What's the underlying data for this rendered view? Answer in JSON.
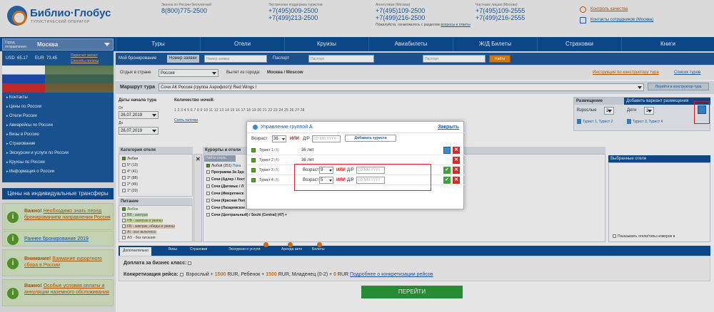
{
  "header": {
    "logo": {
      "name": "Библио·Глобус",
      "tagline": "ТУРИСТИЧЕСКИЙ ОПЕРАТОР"
    },
    "free_calls": {
      "label": "Звонок по России бесплатный",
      "phones": [
        "8(800)775-2500"
      ]
    },
    "emergency": {
      "label": "Экстренная поддержка туристов",
      "phones": [
        "+7(495)009-2500",
        "+7(499)213-2500"
      ]
    },
    "agencies": {
      "label": "Агентствам (Москва)",
      "phones": [
        "+7(495)109-2500",
        "+7(499)216-2500"
      ],
      "note_prefix": "Пожалуйста, ознакомьтесь с разделом",
      "note_link": "вопросы и ответы"
    },
    "private": {
      "label": "Частным лицам (Москва)",
      "phones": [
        "+7(495)109-2555",
        "+7(499)216-2555"
      ]
    },
    "quality_link": "Контроль качества",
    "staff_link": "Контакты сотрудников (Москва)"
  },
  "city": {
    "label": "Город отправления",
    "value": "Москва"
  },
  "nav": [
    "Туры",
    "Отели",
    "Круизы",
    "Авиабилеты",
    "Ж/Д Билеты",
    "Страховки",
    "Книги"
  ],
  "rates": {
    "usd_label": "USD",
    "usd": "65.17",
    "eur_label": "EUR",
    "eur": "73.45",
    "links": [
      "Пересчет валют",
      "Способы оплаты"
    ]
  },
  "bookbar": {
    "my_booking": "Мой бронирование",
    "order_label": "Номер заявки",
    "order_placeholder": "Номер заявки",
    "passport_label": "Паспорт",
    "passport_placeholder": "Паспорт",
    "find": "Найти"
  },
  "menu": [
    "Контакты",
    "Цены по России",
    "Отели России",
    "Авиарейсы по России",
    "Визы в Россию",
    "Страхование",
    "Экскурсии и услуги по России",
    "Круизы по России",
    "Информация о России"
  ],
  "transfers": "Цены на индивидуальные трансферы",
  "promos": [
    {
      "lead": "Важно!",
      "text": "Необходимо знать перед бронированием направления Россия"
    },
    {
      "lead": "",
      "text": "Раннее бронирование 2019"
    },
    {
      "lead": "Внимание!",
      "text": "Взимание курортного сбора в России"
    },
    {
      "lead": "Важно!",
      "text": "Особые условия оплаты и аннуляции наземного обслуживания"
    }
  ],
  "filters": {
    "rest_label": "Отдых в стране",
    "country": "Россия",
    "from_label": "Вылет из города:",
    "from_value": "Москва / Moscow",
    "constructor_link": "Инструкция по конструктору тура",
    "list_link": "Список туров",
    "route_label": "Маршрут тура",
    "route_value": "Сочи АК Россия (группа Аэрофлот)/ Red Wings  !",
    "route_btn": "Перейти в конструктор тура",
    "dates_label": "Даты начала тура",
    "from": "От",
    "date_from": "26.07.2019",
    "to": "До",
    "date_to": "26.07.2019",
    "nights_label": "Количество ночей:",
    "nights": "1 2 3 4 5 6 7 8 9 10 11 12 13 14 15 16 17 18 19 20 21 22 23 24 25 26 27 28",
    "reset": "Снять галочки"
  },
  "placement": {
    "header": "Размещение",
    "add_variant": "Добавить вариант размещения",
    "adults_label": "Взрослые",
    "adults": "2",
    "children_label": "Дети",
    "children": "2",
    "tourists_a": "Турист 1, Турист 2",
    "tourists_b": "Турист 3, Турист 4"
  },
  "category": {
    "header": "Категория отеля",
    "items": [
      "Любая",
      "5* (13)",
      "4* (41)",
      "3* (88)",
      "2* (45)",
      "1* (23)"
    ]
  },
  "meals": {
    "header": "Питание",
    "items": [
      "Любое",
      "BB - завтрак",
      "HB - завтрак и ужины",
      "FB - завтрак, обеды и ужины",
      "AI - все включено",
      "AO - без питания"
    ]
  },
  "resorts": {
    "header": "Курорты и отели",
    "find_all": "Найти отель",
    "any": "Любой (251)",
    "any_link": "Пока",
    "items": [
      "Программа За Здо",
      "Сочи (Адлер / Хост",
      "Сочи (Дагомыс / Л",
      "Сочи (Имеретинск",
      "Сочи (Красная Пол",
      "Сочи (Лазаревское / Лоо) (Lazarevskoe / Loo)  (62)  +",
      "Сочи (Центральный) / Sochi (Central)  (47)  +"
    ]
  },
  "selected": {
    "header": "Выбранные отели",
    "show_link": "Показывать отели/типы номеров в"
  },
  "tabs": [
    "Дополнительно",
    "Визы",
    "Страховки",
    "Экскурсии и услуги",
    "Аренда авто",
    "Билеты"
  ],
  "services": {
    "business_label": "Доплата за бизнес класс:",
    "flight_label": "Конкретизация рейса:",
    "flight_text_adult": "Взрослый +",
    "flight_adult_price": "1500",
    "flight_rur": "RUR, Ребенок +",
    "flight_child_price": "1500",
    "flight_rur2": "RUR, Младенец (0-2) +",
    "flight_infant_price": "0",
    "flight_rur3": "RUR",
    "flight_link": "Подробнее о конкретизации рейсов"
  },
  "go_button": "ПЕРЕЙТИ",
  "modal": {
    "title": "Управление группой A",
    "close": "Закрыть",
    "age_label": "Возраст",
    "age_value": "36",
    "or_label": "ИЛИ",
    "dob_label": "Д/Р",
    "dob_placeholder": "DD.MM.YYYY",
    "add_tourist": "Добавить туриста",
    "rows": [
      {
        "name": "Турист 1",
        "group": "(A)",
        "age": "36 лет"
      },
      {
        "name": "Турист 2",
        "group": "(A)",
        "age": "36 лет"
      },
      {
        "name": "Турист 3",
        "group": "(A)",
        "age": "9"
      },
      {
        "name": "Турист 4",
        "group": "(A)",
        "age": "5"
      }
    ]
  }
}
